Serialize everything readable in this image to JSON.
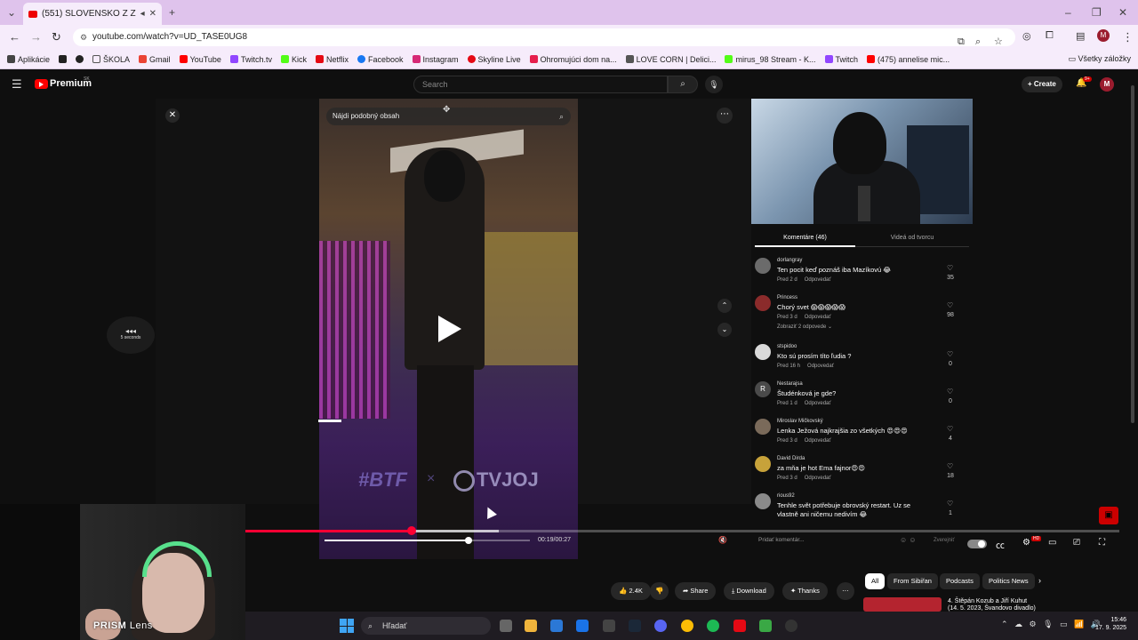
{
  "browser": {
    "tab_title": "(551) SLOVENSKO Z ZTRACENÝ...",
    "url": "youtube.com/watch?v=UD_TASE0UG8",
    "bookmarks": [
      {
        "label": "Aplikácie",
        "color": "#444444"
      },
      {
        "label": "",
        "color": "#222222"
      },
      {
        "label": "",
        "color": "#222222"
      },
      {
        "label": "ŠKOLA",
        "color": "#333333"
      },
      {
        "label": "Gmail",
        "color": "#ea4335"
      },
      {
        "label": "YouTube",
        "color": "#ff0000"
      },
      {
        "label": "Twitch.tv",
        "color": "#9146ff"
      },
      {
        "label": "Kick",
        "color": "#53fc18"
      },
      {
        "label": "Netflix",
        "color": "#e50914"
      },
      {
        "label": "Facebook",
        "color": "#1877f2"
      },
      {
        "label": "Instagram",
        "color": "#d62976"
      },
      {
        "label": "Skyline Live",
        "color": "#e50914"
      },
      {
        "label": "Ohromujúci dom na...",
        "color": "#e61e4d"
      },
      {
        "label": "LOVE CORN | Delici...",
        "color": "#555555"
      },
      {
        "label": "mirus_98 Stream - K...",
        "color": "#53fc18"
      },
      {
        "label": "Twitch",
        "color": "#9146ff"
      },
      {
        "label": "(475) annelise mic...",
        "color": "#ff0000"
      }
    ],
    "all_bookmarks": "Všetky záložky"
  },
  "youtube": {
    "logo_text": "Premium",
    "logo_sup": "SK",
    "search_placeholder": "Search",
    "create_label": "Create",
    "notif_count": "9+",
    "avatar_letter": "M"
  },
  "player": {
    "find_similar": "Nájdi podobný obsah",
    "seek_label": "5 seconds",
    "watermark_left": "#BTF",
    "watermark_x": "×",
    "watermark_right": "TVJOJ",
    "time": "00:19/00:27",
    "progress": 0.19,
    "buffered": 0.29,
    "scrub_progress": 0.7
  },
  "comments": {
    "tab_comments": "Komentáre (46)",
    "tab_videos": "Videá od tvorcu",
    "items": [
      {
        "author": "dorlangray",
        "text": "Ten pocit keď poznáš iba Mazíkovú 😂",
        "time": "Pred 2 d",
        "reply": "Odpovedať",
        "likes": "35",
        "avatar_color": "#6b6b6b",
        "avatar_letter": ""
      },
      {
        "author": "Princess",
        "text": "Chorý svet 😱😱😱😱😱",
        "time": "Pred 3 d",
        "reply": "Odpovedať",
        "likes": "98",
        "avatar_color": "#8b2b2b",
        "avatar_letter": "",
        "replies": "Zobraziť 2 odpovede"
      },
      {
        "author": "stspidoo",
        "text": "Kto sú prosím títo ľudia ?",
        "time": "Pred 16 h",
        "reply": "Odpovedať",
        "likes": "0",
        "avatar_color": "#d9d9d9",
        "avatar_letter": ""
      },
      {
        "author": "Nestarajsa",
        "text": "Študénková je gde?",
        "time": "Pred 1 d",
        "reply": "Odpovedať",
        "likes": "0",
        "avatar_color": "#4a4a4a",
        "avatar_letter": "R"
      },
      {
        "author": "Miroslav Mičkovský",
        "text": "Lenka Ježová najkrajšia zo všetkých 😍😍😍",
        "time": "Pred 3 d",
        "reply": "Odpovedať",
        "likes": "4",
        "avatar_color": "#7a6a5a",
        "avatar_letter": ""
      },
      {
        "author": "David Dirda",
        "text": "za mňa je hot Ema fajnor😍😍",
        "time": "Pred 3 d",
        "reply": "Odpovedať",
        "likes": "18",
        "avatar_color": "#c7a23a",
        "avatar_letter": ""
      },
      {
        "author": "rious92",
        "text": "Tenhle svět potřebuje obrovský restart. Uz se",
        "text2": "vlastně ani ničemu nedivím 😂",
        "time": "",
        "reply": "",
        "likes": "1",
        "avatar_color": "#8a8a8a",
        "avatar_letter": ""
      }
    ],
    "add_comment": "Pridať komentár...",
    "send": "Zverejniť"
  },
  "actions": {
    "likes": "2.4K",
    "share": "Share",
    "download": "Download",
    "thanks": "Thanks",
    "chips": [
      "All",
      "From Sibiřan",
      "Podcasts",
      "Politics News"
    ],
    "next_title": "4. Štěpán Kozub a Jiří Kuhut (14. 5. 2023, Švandovo divadlo) ?"
  },
  "facecam": {
    "label_bold": "PRISM",
    "label_rest": " Lens"
  },
  "taskbar": {
    "search": "Hľadať",
    "time": "15:46",
    "date": "17. 9. 2025"
  }
}
